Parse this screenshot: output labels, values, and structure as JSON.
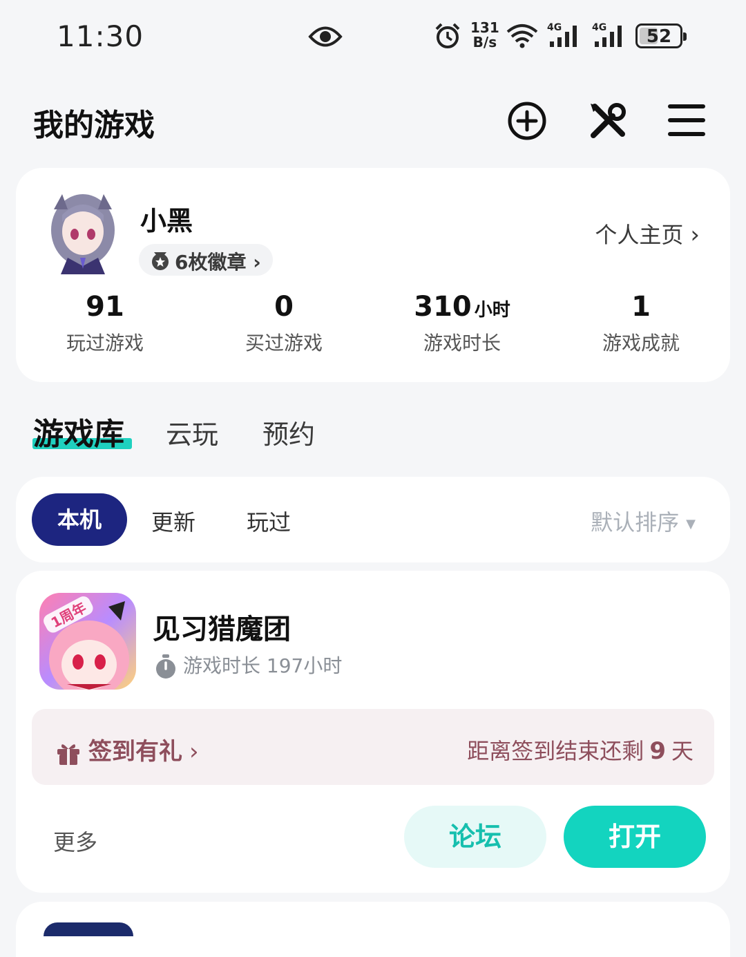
{
  "status_bar": {
    "time": "11:30",
    "net_speed_value": "131",
    "net_speed_unit": "B/s",
    "signal_1_label": "4G",
    "signal_2_label": "4G",
    "battery": "52"
  },
  "header": {
    "title": "我的游戏"
  },
  "profile": {
    "username": "小黑",
    "badges_label": "6枚徽章",
    "homepage_link": "个人主页",
    "stats": [
      {
        "value": "91",
        "unit": "",
        "label": "玩过游戏"
      },
      {
        "value": "0",
        "unit": "",
        "label": "买过游戏"
      },
      {
        "value": "310",
        "unit": "小时",
        "label": "游戏时长"
      },
      {
        "value": "1",
        "unit": "",
        "label": "游戏成就"
      }
    ]
  },
  "tabs": [
    {
      "label": "游戏库",
      "active": true
    },
    {
      "label": "云玩",
      "active": false
    },
    {
      "label": "预约",
      "active": false
    }
  ],
  "filters": {
    "items": [
      {
        "label": "本机",
        "active": true
      },
      {
        "label": "更新",
        "active": false
      },
      {
        "label": "玩过",
        "active": false
      }
    ],
    "sort_label": "默认排序"
  },
  "game": {
    "icon_badge": "1周年",
    "title": "见习猎魔团",
    "playtime_label": "游戏时长 197小时",
    "checkin_label": "签到有礼",
    "checkin_remaining_prefix": "距离签到结束还剩",
    "checkin_remaining_days": "9",
    "checkin_remaining_suffix": "天",
    "more_label": "更多",
    "forum_label": "论坛",
    "open_label": "打开"
  },
  "colors": {
    "accent_teal": "#13d4bf",
    "filter_active": "#1d2580",
    "checkin_text": "#8e4e5c"
  }
}
